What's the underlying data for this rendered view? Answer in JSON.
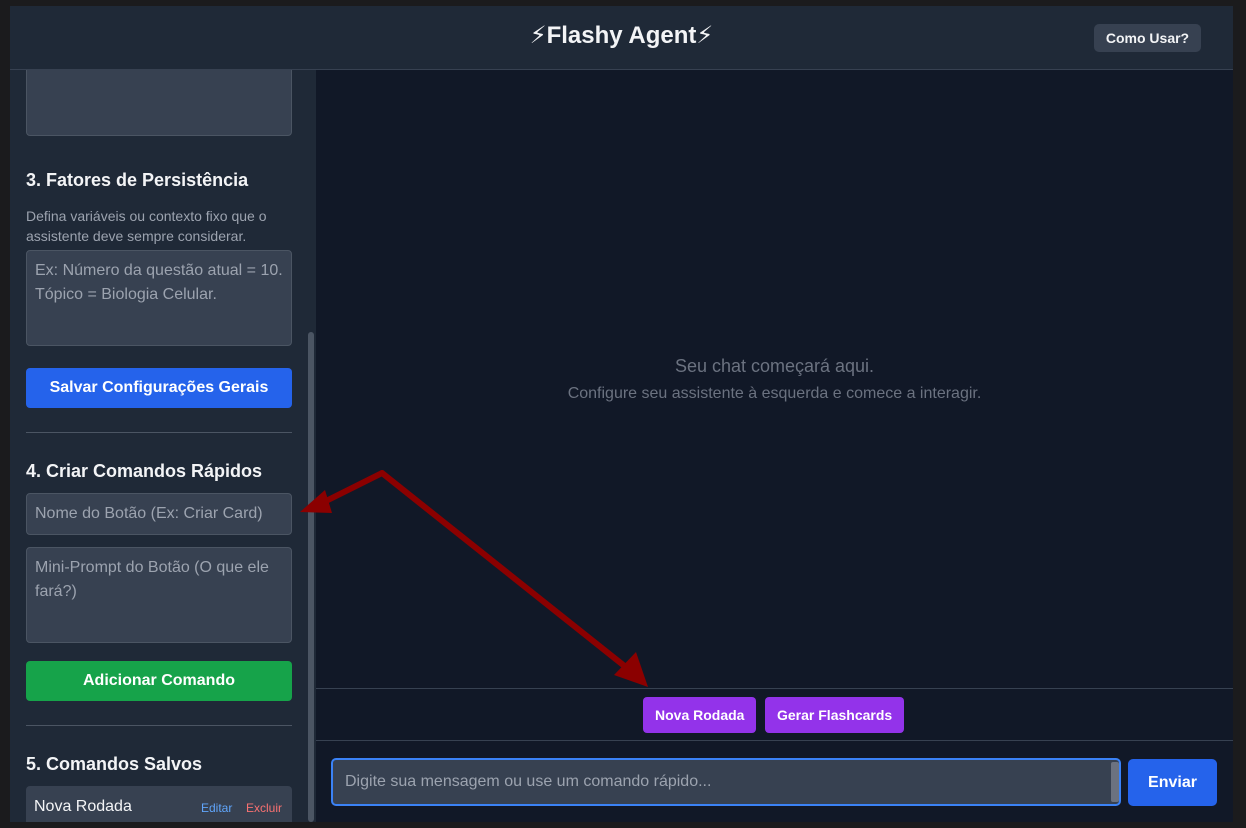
{
  "header": {
    "title": "⚡Flashy Agent⚡",
    "help_label": "Como Usar?"
  },
  "sidebar": {
    "top_textarea_value": "",
    "section3": {
      "heading": "3. Fatores de Persistência",
      "description": "Defina variáveis ou contexto fixo que o assistente deve sempre considerar.",
      "placeholder": "Ex: Número da questão atual = 10. Tópico = Biologia Celular.",
      "save_label": "Salvar Configurações Gerais"
    },
    "section4": {
      "heading": "4. Criar Comandos Rápidos",
      "name_placeholder": "Nome do Botão (Ex: Criar Card)",
      "prompt_placeholder": "Mini-Prompt do Botão (O que ele fará?)",
      "add_label": "Adicionar Comando"
    },
    "section5": {
      "heading": "5. Comandos Salvos",
      "items": [
        {
          "name": "Nova Rodada",
          "edit": "Editar",
          "delete": "Excluir"
        }
      ]
    }
  },
  "chat": {
    "empty_line1": "Seu chat começará aqui.",
    "empty_line2": "Configure seu assistente à esquerda e comece a interagir.",
    "quick_commands": [
      "Nova Rodada",
      "Gerar Flashcards"
    ],
    "input_placeholder": "Digite sua mensagem ou use um comando rápido...",
    "send_label": "Enviar"
  },
  "colors": {
    "annotation_arrow": "#8b0000",
    "quick_command": "#9333ea",
    "primary": "#2563eb",
    "success": "#16a34a"
  }
}
